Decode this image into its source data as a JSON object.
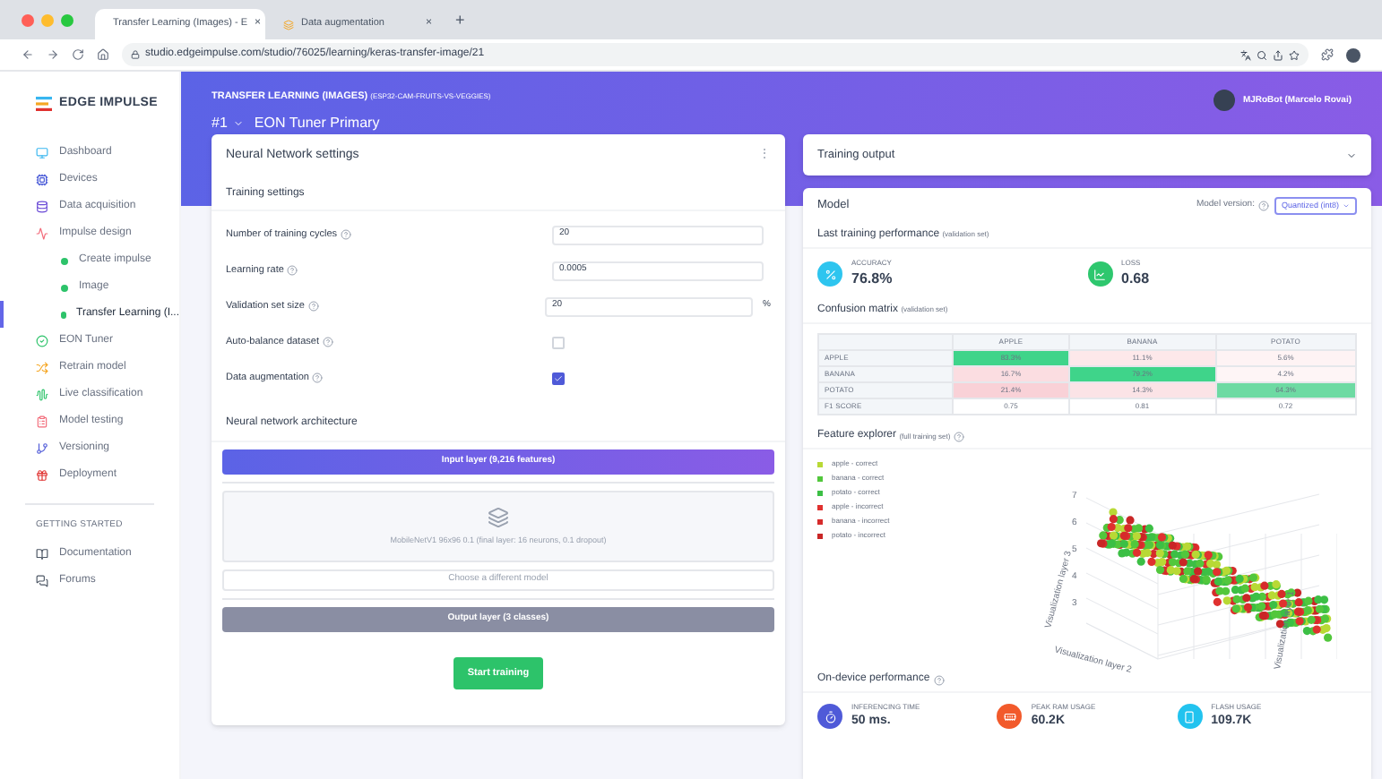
{
  "browser": {
    "tabs": [
      {
        "title": "Transfer Learning (Images) - E",
        "selected": true
      },
      {
        "title": "Data augmentation",
        "selected": false
      }
    ],
    "tab_close": "×",
    "new_tab": "+",
    "url": "studio.edgeimpulse.com/studio/76025/learning/keras-transfer-image/21"
  },
  "brand": "EDGE IMPULSE",
  "sidebar": {
    "items": [
      {
        "label": "Dashboard",
        "selected": false
      },
      {
        "label": "Devices",
        "selected": false
      },
      {
        "label": "Data acquisition",
        "selected": false
      },
      {
        "label": "Impulse design",
        "selected": false,
        "children": [
          {
            "label": "Create impulse",
            "selected": false
          },
          {
            "label": "Image",
            "selected": false
          },
          {
            "label": "Transfer Learning (I...",
            "selected": true
          }
        ]
      },
      {
        "label": "EON Tuner",
        "selected": false
      },
      {
        "label": "Retrain model",
        "selected": false
      },
      {
        "label": "Live classification",
        "selected": false
      },
      {
        "label": "Model testing",
        "selected": false
      },
      {
        "label": "Versioning",
        "selected": false
      },
      {
        "label": "Deployment",
        "selected": false
      }
    ],
    "section_title": "GETTING STARTED",
    "section_items": [
      {
        "label": "Documentation",
        "selected": false
      },
      {
        "label": "Forums",
        "selected": false
      }
    ]
  },
  "header": {
    "title": "TRANSFER LEARNING (IMAGES)",
    "project": "(ESP32-CAM-FRUITS-VS-VEGGIES)",
    "number": "#1",
    "name": "EON Tuner Primary",
    "user": "MJRoBot (Marcelo Rovai)"
  },
  "settings": {
    "title": "Neural Network settings",
    "menu": "⋮",
    "section": "Training settings",
    "fields": [
      {
        "kind": "number",
        "label": "Number of training cycles",
        "value": "20"
      },
      {
        "kind": "number",
        "label": "Learning rate",
        "value": "0.0005"
      },
      {
        "kind": "number",
        "label": "Validation set size",
        "value": "20",
        "unit": "%"
      },
      {
        "kind": "checkbox",
        "label": "Auto-balance dataset",
        "checked": false
      },
      {
        "kind": "checkbox",
        "label": "Data augmentation",
        "checked": true
      }
    ],
    "arch_title": "Neural network architecture",
    "input_layer": "Input layer (9,216 features)",
    "model": "MobileNetV1 96x96 0.1 (final layer: 16 neurons, 0.1 dropout)",
    "choose": "Choose a different model",
    "output_layer": "Output layer (3 classes)",
    "start": "Start training"
  },
  "output": {
    "title": "Training output",
    "model_title": "Model",
    "version_label": "Model version:",
    "version": "Quantized (int8)",
    "perf_title": "Last training performance",
    "perf_note": "(validation set)",
    "metrics": [
      {
        "label": "ACCURACY",
        "value": "76.8%",
        "color": "#2ec5ef"
      },
      {
        "label": "LOSS",
        "value": "0.68",
        "color": "#2ec76e"
      }
    ],
    "confusion_title": "Confusion matrix",
    "confusion_note": "(validation set)",
    "columns": [
      "APPLE",
      "BANANA",
      "POTATO"
    ],
    "rows": [
      {
        "label": "APPLE",
        "cells": [
          {
            "text": "83.3%",
            "color": "#3fd48a"
          },
          {
            "text": "11.1%",
            "color": "#fde8ea"
          },
          {
            "text": "5.6%",
            "color": "#fef3f4"
          }
        ]
      },
      {
        "label": "BANANA",
        "cells": [
          {
            "text": "16.7%",
            "color": "#fbdde1"
          },
          {
            "text": "79.2%",
            "color": "#3fd48a"
          },
          {
            "text": "4.2%",
            "color": "#fef5f6"
          }
        ]
      },
      {
        "label": "POTATO",
        "cells": [
          {
            "text": "21.4%",
            "color": "#f9d1d7"
          },
          {
            "text": "14.3%",
            "color": "#fbe3e6"
          },
          {
            "text": "64.3%",
            "color": "#6ddaa3"
          }
        ]
      },
      {
        "label": "F1 SCORE",
        "cells": [
          {
            "text": "0.75",
            "color": "#ffffff"
          },
          {
            "text": "0.81",
            "color": "#ffffff"
          },
          {
            "text": "0.72",
            "color": "#ffffff"
          }
        ]
      }
    ],
    "explorer_title": "Feature explorer",
    "explorer_note": "(full training set)",
    "legend": [
      {
        "label": "apple - correct",
        "color": "#b8d935"
      },
      {
        "label": "banana - correct",
        "color": "#52c73c"
      },
      {
        "label": "potato - correct",
        "color": "#3cbf45"
      },
      {
        "label": "apple - incorrect",
        "color": "#e0312f"
      },
      {
        "label": "banana - incorrect",
        "color": "#d62b2b"
      },
      {
        "label": "potato - incorrect",
        "color": "#c92626"
      }
    ],
    "y_ticks": [
      "7",
      "6",
      "5",
      "4",
      "3"
    ],
    "axis_labels": [
      "Visualization layer 3",
      "Visualization layer 2",
      "Visualization layer 1"
    ],
    "device_title": "On-device performance",
    "device": [
      {
        "label": "INFERENCING TIME",
        "value": "50 ms.",
        "color": "#4f5ad8"
      },
      {
        "label": "PEAK RAM USAGE",
        "value": "60.2K",
        "color": "#f25a2b"
      },
      {
        "label": "FLASH USAGE",
        "value": "109.7K",
        "color": "#22c3ef"
      }
    ]
  }
}
